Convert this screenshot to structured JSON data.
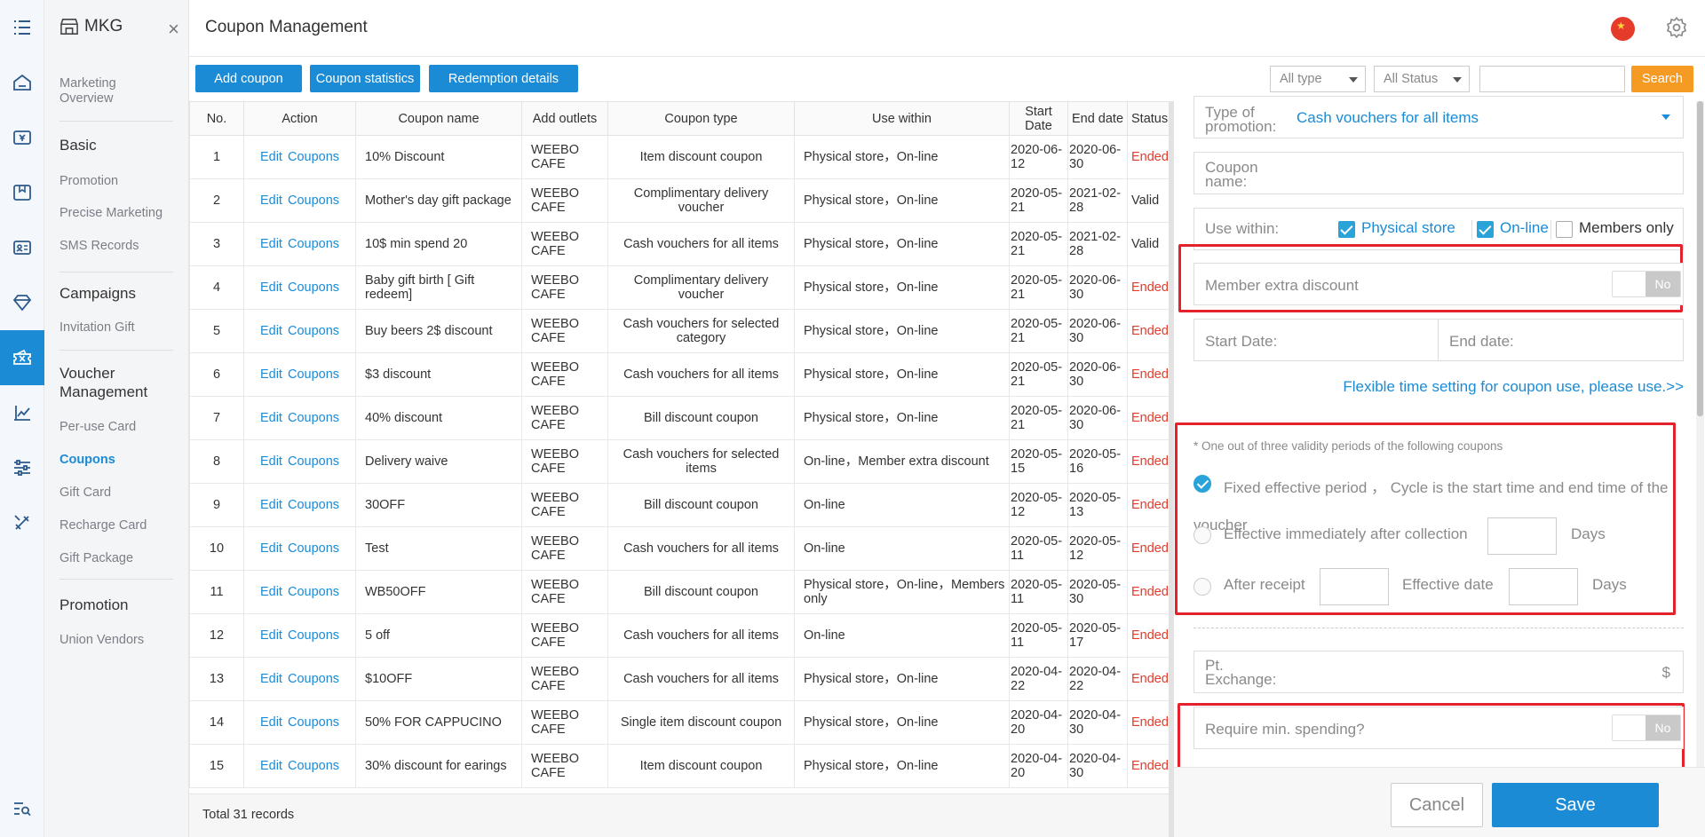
{
  "app": {
    "name": "MKG",
    "page_title": "Coupon Management"
  },
  "sidebar": {
    "overview": "Marketing Overview",
    "sections": [
      {
        "title": "Basic",
        "items": [
          "Promotion",
          "Precise Marketing",
          "SMS Records"
        ]
      },
      {
        "title": "Campaigns",
        "items": [
          "Invitation Gift"
        ]
      },
      {
        "title": "Voucher Management",
        "items": [
          "Per-use Card",
          "Coupons",
          "Gift Card",
          "Recharge Card",
          "Gift Package"
        ]
      },
      {
        "title": "Promotion",
        "items": [
          "Union Vendors"
        ]
      }
    ],
    "active_item": "Coupons"
  },
  "toolbar": {
    "add_coupon": "Add coupon",
    "coupon_statistics": "Coupon statistics",
    "redemption_details": "Redemption details",
    "type_filter": "All type",
    "status_filter": "All Status",
    "search_value": "",
    "search_button": "Search"
  },
  "table": {
    "headers": [
      "No.",
      "Action",
      "Coupon name",
      "Add outlets",
      "Coupon type",
      "Use within",
      "Start Date",
      "End date",
      "Status"
    ],
    "action_edit": "Edit",
    "action_coupons": "Coupons",
    "rows": [
      {
        "no": "1",
        "name": "10% Discount",
        "outlets": "WEEBO CAFE",
        "type": "Item discount coupon",
        "use_within": "Physical store，On-line",
        "start": "2020-06-12",
        "end": "2020-06-30",
        "status": "Ended"
      },
      {
        "no": "2",
        "name": "Mother's day gift package",
        "outlets": "WEEBO CAFE",
        "type": "Complimentary delivery voucher",
        "use_within": "Physical store，On-line",
        "start": "2020-05-21",
        "end": "2021-02-28",
        "status": "Valid"
      },
      {
        "no": "3",
        "name": "10$ min spend 20",
        "outlets": "WEEBO CAFE",
        "type": "Cash vouchers for all items",
        "use_within": "Physical store，On-line",
        "start": "2020-05-21",
        "end": "2021-02-28",
        "status": "Valid"
      },
      {
        "no": "4",
        "name": "Baby gift birth [ Gift redeem]",
        "outlets": "WEEBO CAFE",
        "type": "Complimentary delivery voucher",
        "use_within": "Physical store，On-line",
        "start": "2020-05-21",
        "end": "2020-06-30",
        "status": "Ended"
      },
      {
        "no": "5",
        "name": "Buy beers 2$ discount",
        "outlets": "WEEBO CAFE",
        "type": "Cash vouchers for selected category",
        "use_within": "Physical store，On-line",
        "start": "2020-05-21",
        "end": "2020-06-30",
        "status": "Ended"
      },
      {
        "no": "6",
        "name": "$3 discount",
        "outlets": "WEEBO CAFE",
        "type": "Cash vouchers for all items",
        "use_within": "Physical store，On-line",
        "start": "2020-05-21",
        "end": "2020-06-30",
        "status": "Ended"
      },
      {
        "no": "7",
        "name": "40% discount",
        "outlets": "WEEBO CAFE",
        "type": "Bill discount coupon",
        "use_within": "Physical store，On-line",
        "start": "2020-05-21",
        "end": "2020-06-30",
        "status": "Ended"
      },
      {
        "no": "8",
        "name": "Delivery waive",
        "outlets": "WEEBO CAFE",
        "type": "Cash vouchers for selected items",
        "use_within": "On-line，Member extra discount",
        "start": "2020-05-15",
        "end": "2020-05-16",
        "status": "Ended"
      },
      {
        "no": "9",
        "name": "30OFF",
        "outlets": "WEEBO CAFE",
        "type": "Bill discount coupon",
        "use_within": "On-line",
        "start": "2020-05-12",
        "end": "2020-05-13",
        "status": "Ended"
      },
      {
        "no": "10",
        "name": "Test",
        "outlets": "WEEBO CAFE",
        "type": "Cash vouchers for all items",
        "use_within": "On-line",
        "start": "2020-05-11",
        "end": "2020-05-12",
        "status": "Ended"
      },
      {
        "no": "11",
        "name": "WB50OFF",
        "outlets": "WEEBO CAFE",
        "type": "Bill discount coupon",
        "use_within": "Physical store，On-line，Members only",
        "start": "2020-05-11",
        "end": "2020-05-30",
        "status": "Ended"
      },
      {
        "no": "12",
        "name": "5 off",
        "outlets": "WEEBO CAFE",
        "type": "Cash vouchers for all items",
        "use_within": "On-line",
        "start": "2020-05-11",
        "end": "2020-05-17",
        "status": "Ended"
      },
      {
        "no": "13",
        "name": "$10OFF",
        "outlets": "WEEBO CAFE",
        "type": "Cash vouchers for all items",
        "use_within": "Physical store，On-line",
        "start": "2020-04-22",
        "end": "2020-04-22",
        "status": "Ended"
      },
      {
        "no": "14",
        "name": "50% FOR CAPPUCINO",
        "outlets": "WEEBO CAFE",
        "type": "Single item discount coupon",
        "use_within": "Physical store，On-line",
        "start": "2020-04-20",
        "end": "2020-04-30",
        "status": "Ended"
      },
      {
        "no": "15",
        "name": "30% discount for earings",
        "outlets": "WEEBO CAFE",
        "type": "Item discount coupon",
        "use_within": "Physical store，On-line",
        "start": "2020-04-20",
        "end": "2020-04-30",
        "status": "Ended"
      }
    ],
    "total": "Total 31 records"
  },
  "panel": {
    "type_label": "Type of promotion:",
    "type_value": "Cash vouchers for all items",
    "name_label": "Coupon name:",
    "use_within_label": "Use within:",
    "opt_physical": "Physical store",
    "opt_online": "On-line",
    "opt_members": "Members only",
    "member_discount_label": "Member extra discount",
    "toggle_no": "No",
    "start_label": "Start Date:",
    "end_label": "End date:",
    "flexible_link": "Flexible time setting for coupon use, please use.>>",
    "validity_note": "* One out of three validity periods of the following coupons",
    "fixed_period_line1": "Fixed effective period ，  Cycle is the start time and end time of the",
    "fixed_period_line2": "voucher",
    "immediate": "Effective immediately after collection",
    "days": "Days",
    "after_receipt": "After receipt",
    "effective_date": "Effective date",
    "pt_exchange_label": "Pt. Exchange:",
    "currency": "$",
    "min_spending_label": "Require min. spending?",
    "cancel": "Cancel",
    "save": "Save"
  },
  "colors": {
    "accent": "#1b8bd6",
    "search": "#f59a23",
    "ended": "#e53b2b",
    "highlight": "#e3222b"
  }
}
